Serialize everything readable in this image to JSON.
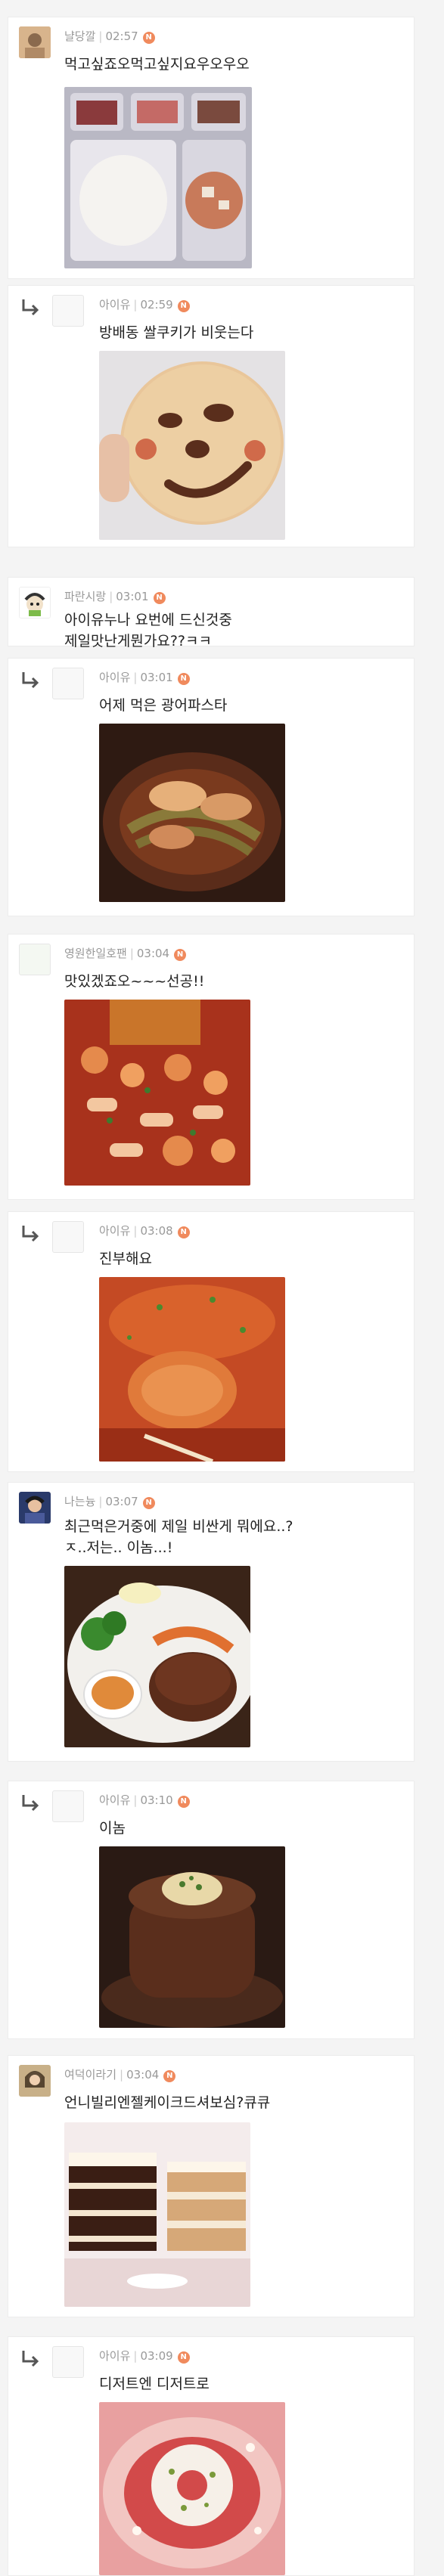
{
  "comments": [
    {
      "author": "냘당깔",
      "time": "02:57",
      "badge": "N",
      "text": "먹고싶죠오먹고싶지요우오우오",
      "image": "meal-tray-photo",
      "reply": false
    },
    {
      "author": "아이유",
      "time": "02:59",
      "badge": "N",
      "text": "방배동 쌀쿠키가 비웃는다",
      "image": "smiley-cookie-photo",
      "reply": true
    },
    {
      "author": "파란시랑",
      "time": "03:01",
      "badge": "N",
      "text": "아이유누나 요번에 드신것중\n제일맛난게뭔가요??ㅋㅋ",
      "image": "",
      "reply": false
    },
    {
      "author": "아이유",
      "time": "03:01",
      "badge": "N",
      "text": "어제 먹은 광어파스타",
      "image": "flounder-pasta-photo",
      "reply": true
    },
    {
      "author": "영원한일호팬",
      "time": "03:04",
      "badge": "N",
      "text": "맛있겠죠오~~~선공!!",
      "image": "tteokbokki-cutlet-photo",
      "reply": false
    },
    {
      "author": "아이유",
      "time": "03:08",
      "badge": "N",
      "text": "진부해요",
      "image": "rice-cake-sauce-photo",
      "reply": true
    },
    {
      "author": "나는늉",
      "time": "03:07",
      "badge": "N",
      "text": "최근먹은거중에 제일 비싼게 뭐에요..?\nㅈ..저는.. 이놈...!",
      "image": "steak-plate-photo",
      "reply": false
    },
    {
      "author": "아이유",
      "time": "03:10",
      "badge": "N",
      "text": "이놈",
      "image": "thick-steak-photo",
      "reply": true
    },
    {
      "author": "여덕이라기",
      "time": "03:04",
      "badge": "N",
      "text": "언니빌리엔젤케이크드셔보심?큐큐",
      "image": "layer-cakes-photo",
      "reply": false
    },
    {
      "author": "아이유",
      "time": "03:09",
      "badge": "N",
      "text": "디저트엔 디저트로",
      "image": "dessert-bowl-photo",
      "reply": true
    }
  ]
}
